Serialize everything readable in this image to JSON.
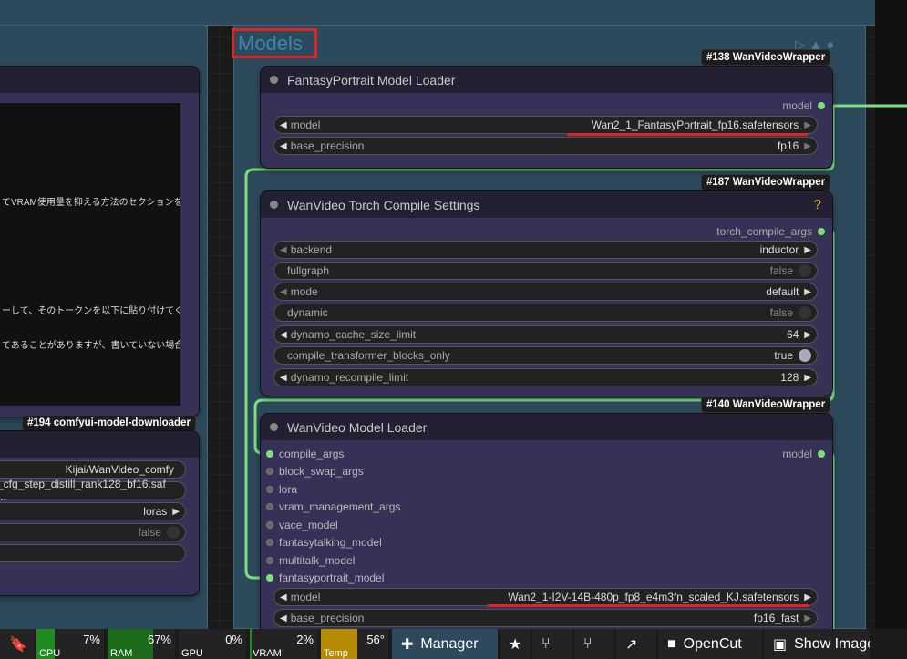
{
  "group": {
    "title": "Models"
  },
  "left_node": {
    "badge": "#194 comfyui-model-downloader",
    "text_lines": [
      "てVRAM使用量を抑える方法のセクションを読",
      "ーして、そのトークンを以下に貼り付けてくだ",
      "てあることがありますが、書いていない場合"
    ],
    "widgets": [
      {
        "value": "Kijai/WanVideo_comfy"
      },
      {
        "value": "_cfg_step_distill_rank128_bf16.saf ..."
      },
      {
        "value": "loras"
      },
      {
        "value": "false"
      },
      {
        "value": ""
      }
    ]
  },
  "node138": {
    "badge": "#138 WanVideoWrapper",
    "title": "FantasyPortrait Model Loader",
    "output": "model",
    "widgets": [
      {
        "name": "model",
        "value": "Wan2_1_FantasyPortrait_fp16.safetensors"
      },
      {
        "name": "base_precision",
        "value": "fp16"
      }
    ]
  },
  "node187": {
    "badge": "#187 WanVideoWrapper",
    "title": "WanVideo Torch Compile Settings",
    "help": "?",
    "output": "torch_compile_args",
    "widgets": [
      {
        "name": "backend",
        "value": "inductor"
      },
      {
        "name": "fullgraph",
        "value": "false"
      },
      {
        "name": "mode",
        "value": "default"
      },
      {
        "name": "dynamic",
        "value": "false"
      },
      {
        "name": "dynamo_cache_size_limit",
        "value": "64"
      },
      {
        "name": "compile_transformer_blocks_only",
        "value": "true"
      },
      {
        "name": "dynamo_recompile_limit",
        "value": "128"
      }
    ]
  },
  "node140": {
    "badge": "#140 WanVideoWrapper",
    "title": "WanVideo Model Loader",
    "output": "model",
    "inputs": [
      "compile_args",
      "block_swap_args",
      "lora",
      "vram_management_args",
      "vace_model",
      "fantasytalking_model",
      "multitalk_model",
      "fantasyportrait_model"
    ],
    "widgets": [
      {
        "name": "model",
        "value": "Wan2_1-I2V-14B-480p_fp8_e4m3fn_scaled_KJ.safetensors"
      },
      {
        "name": "base_precision",
        "value": "fp16_fast"
      }
    ]
  },
  "taskbar": {
    "meters": [
      {
        "label": "CPU",
        "value": "7%",
        "level": 0.07,
        "color": "#1e8c1e"
      },
      {
        "label": "RAM",
        "value": "67%",
        "level": 0.67,
        "color": "#1a6b1a"
      },
      {
        "label": "GPU",
        "value": "0%",
        "level": 0.0,
        "color": "#1e8c1e"
      },
      {
        "label": "VRAM",
        "value": "2%",
        "level": 0.02,
        "color": "#1e8c1e"
      },
      {
        "label": "Temp",
        "value": "56°",
        "level": 0.56,
        "color": "#b38a00"
      }
    ],
    "manager_label": "Manager",
    "opencut_label": "OpenCut",
    "show_image_label": "Show Image"
  },
  "colors": {
    "link": "#7de07d",
    "accent": "#e02424",
    "node_bg": "#353157"
  }
}
